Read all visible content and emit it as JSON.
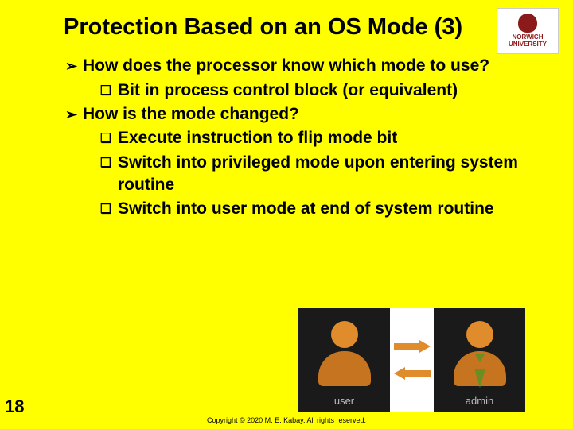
{
  "title": "Protection Based on an OS Mode (3)",
  "logo": {
    "line1": "NORWICH",
    "line2": "UNIVERSITY"
  },
  "bullets": {
    "b1": "How does the processor know which mode to use?",
    "b1a": "Bit in process control block (or equivalent)",
    "b2": "How is the mode changed?",
    "b2a": "Execute instruction to flip mode bit",
    "b2b": "Switch into privileged mode upon entering system routine",
    "b2c": "Switch into user mode at end of system routine"
  },
  "diagram": {
    "left_label": "user",
    "right_label": "admin"
  },
  "slide_number": "18",
  "copyright": "Copyright © 2020 M. E. Kabay. All rights reserved."
}
